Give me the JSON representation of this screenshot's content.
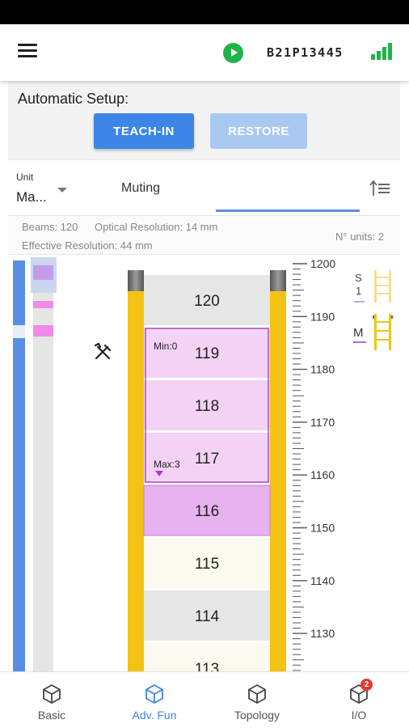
{
  "header": {
    "device_id": "B21P13445"
  },
  "setup": {
    "title": "Automatic Setup:",
    "teach_label": "TEACH-IN",
    "restore_label": "RESTORE"
  },
  "tabs": {
    "unit_label": "Unit",
    "unit_value": "Ma...",
    "muting_label": "Muting"
  },
  "info": {
    "beams": "Beams: 120",
    "optical_resolution": "Optical Resolution: 14 mm",
    "effective_resolution": "Effective Resolution: 44 mm",
    "units_count": "N° units: 2"
  },
  "beam_view": {
    "beams": [
      {
        "number": "120",
        "state": "gray"
      },
      {
        "number": "119",
        "state": "muting-zone"
      },
      {
        "number": "118",
        "state": "muting-zone"
      },
      {
        "number": "117",
        "state": "muting-zone"
      },
      {
        "number": "116",
        "state": "muted"
      },
      {
        "number": "115",
        "state": "cream"
      },
      {
        "number": "114",
        "state": "gray"
      },
      {
        "number": "113",
        "state": "cream"
      }
    ],
    "muting_min_label": "Min:0",
    "muting_max_label": "Max:3",
    "scale_labels": [
      "1200",
      "1190",
      "1180",
      "1170",
      "1160",
      "1150",
      "1140",
      "1130"
    ],
    "unit_s_label": "S",
    "unit_s_index": "1",
    "unit_m_label": "M"
  },
  "colors": {
    "accent": "#3d86e8",
    "green": "#20b34a",
    "muting_fill": "#f3d2f6",
    "muting_border": "#a94fc8",
    "muted_beam": "#e8b1ef",
    "frame_yellow": "#f3c313"
  },
  "bottom_nav": [
    {
      "label": "Basic",
      "icon": "cube-icon",
      "active": false
    },
    {
      "label": "Adv. Fun",
      "icon": "cube-icon",
      "active": true
    },
    {
      "label": "Topology",
      "icon": "cube-icon",
      "active": false
    },
    {
      "label": "I/O",
      "icon": "cube-icon",
      "active": false,
      "badge": "2"
    }
  ]
}
